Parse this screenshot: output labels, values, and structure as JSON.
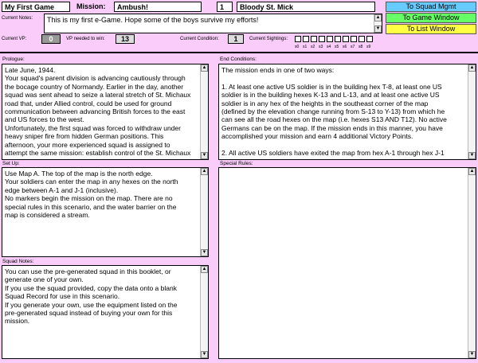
{
  "header": {
    "game_name": "My First Game",
    "mission_label": "Mission:",
    "mission_name": "Ambush!",
    "mission_number": "1",
    "scenario_title": "Bloody St. Mick"
  },
  "nav": {
    "squad": "To Squad Mgmt",
    "game": "To Game Window",
    "list": "To List Window"
  },
  "notes": {
    "label": "Current Notes:",
    "text": "This is my first e-Game. Hope some of the boys survive my efforts!"
  },
  "stats": {
    "vp_label": "Current VP:",
    "vp_value": "0",
    "vp_needed_label": "VP needed to win:",
    "vp_needed_value": "13",
    "condition_label": "Current Condition:",
    "condition_value": "1",
    "sightings_label": "Current Sightings:",
    "sighting_labels": [
      "s0",
      "s1",
      "s2",
      "s3",
      "s4",
      "s5",
      "s6",
      "s7",
      "s8",
      "s9"
    ]
  },
  "prologue": {
    "label": "Prologue:",
    "lines": [
      "Late June, 1944.",
      "Your squad's parent division is advancing cautiously through",
      "the bocage country of Normandy. Earlier in the day, another",
      "squad was sent ahead to seize a lateral stretch of St. Michaux",
      "road that, under Allied control, could be used for ground",
      "communication between advancing British forces to the east",
      "and US forces to the west.",
      "Unfortunately, the first squad was forced to withdraw under",
      "heavy sniper fire from hidden German positions. This",
      "afternoon, your more experienced squad is assigned to",
      "attempt the same mission: establish control of the St. Michaux"
    ]
  },
  "end_conditions": {
    "label": "End Conditions:",
    "lines": [
      "The mission ends in one of two ways:",
      "",
      "1. At least one active US soldier is in the building hex T-8, at least one US",
      "soldier is in the building hexes K-13 and L-13, and at least one active US",
      "soldier is in any hex of the heights in the southeast corner of the map",
      "(defined by the elevation change running from S-13 to Y-13) from which he",
      "can see all the road hexes on the map (i.e. hexes S13 AND T12). No active",
      "Germans can be on the map. If the mission ends in this manner, you have",
      "accomplished your mission and earn 4 additional Victory Points.",
      "",
      "2. All active US soldiers have exited the map from hex A-1 through hex J-1"
    ]
  },
  "setup": {
    "label": "Set Up:",
    "lines": [
      "Use Map A. The top of the map is the north edge.",
      "Your soldiers can enter the map in any hexes on the north",
      "edge between A-1 and J-1 (inclusive).",
      "No markers begin the mission on the map. There are no",
      "special rules in this scenario, and the water barrier on the",
      "map is considered a stream."
    ]
  },
  "special_rules": {
    "label": "Special Rules:",
    "lines": []
  },
  "squad_notes": {
    "label": "Squad Notes:",
    "lines": [
      "You can use the pre-generated squad in this booklet, or",
      "generate one of your own.",
      "If you use the squad provided, copy the data onto a blank",
      "Squad Record for use in this scenario.",
      "If you generate your own, use the equipment listed on the",
      "pre-generated squad instead of buying your own for this",
      "mission."
    ]
  },
  "colors": {
    "background": "#f9ccf9",
    "nav_squad": "#66ccff",
    "nav_game": "#66ff66",
    "nav_list": "#ffff44"
  }
}
